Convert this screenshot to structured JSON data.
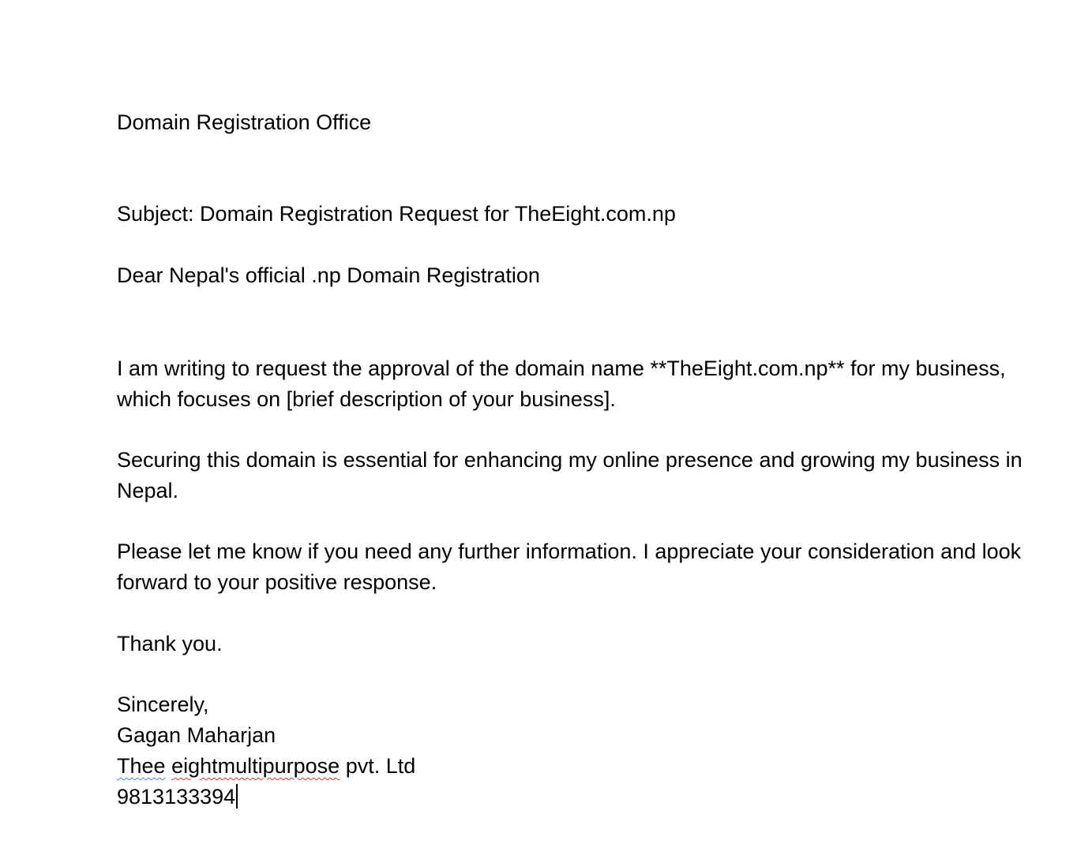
{
  "letter": {
    "office_line": "Domain Registration Office",
    "subject": "Subject: Domain Registration Request for TheEight.com.np",
    "salutation": "Dear Nepal's official .np Domain Registration",
    "paragraphs": [
      "I am writing to request the approval of the domain name **TheEight.com.np** for my business, which focuses on [brief description of your business].",
      "Securing this domain is essential for enhancing my online presence and growing my business in Nepal.",
      "Please let me know if you need any further information. I appreciate your consideration and look forward to your positive response."
    ],
    "thanks": "Thank you.",
    "closing": "Sincerely,",
    "signature_name": "Gagan Maharjan",
    "company": {
      "word_flagged_grammar": "Thee",
      "word_flagged_spelling": "eightmultipurpose",
      "rest": "pvt. Ltd"
    },
    "phone": "9813133394"
  },
  "colors": {
    "spellcheck_grammar": "#4a7fe0",
    "spellcheck_spelling": "#d93025"
  }
}
